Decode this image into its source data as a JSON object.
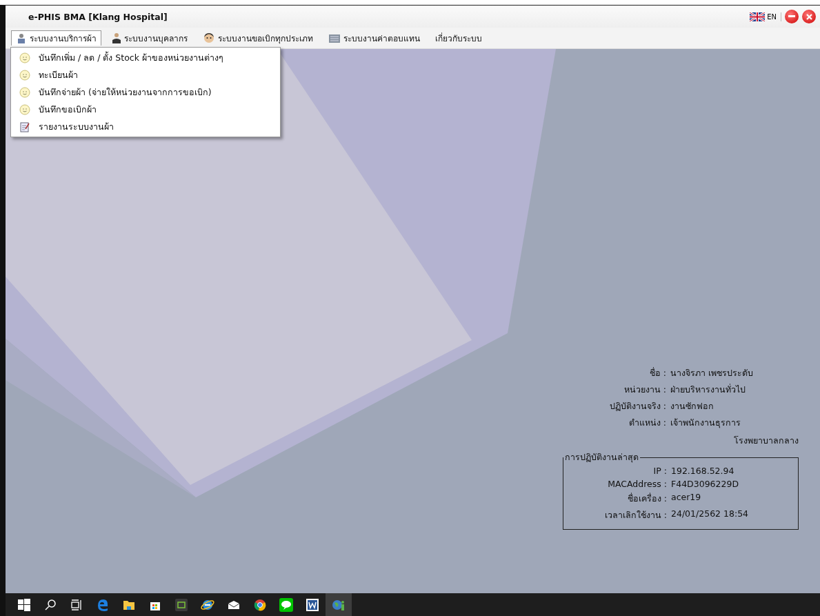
{
  "window": {
    "title": "e-PHIS BMA [Klang Hospital]",
    "language": "EN"
  },
  "menu": [
    {
      "label": "ระบบงานบริการผ้า",
      "kind": "staff",
      "selected": true
    },
    {
      "label": "ระบบงานบุคลากร",
      "kind": "person",
      "selected": false
    },
    {
      "label": "ระบบงานขอเบิกทุกประเภท",
      "kind": "face",
      "selected": false
    },
    {
      "label": "ระบบงานค่าตอบแทน",
      "kind": "building",
      "selected": false
    },
    {
      "label": "เกี่ยวกับระบบ",
      "selected": false
    }
  ],
  "dropdown": [
    {
      "label": "บันทึกเพิ่ม / ลด / ตั้ง Stock ผ้าของหน่วยงานต่างๆ",
      "kind": "face"
    },
    {
      "label": "ทะเบียนผ้า",
      "kind": "face"
    },
    {
      "label": "บันทึกจ่ายผ้า (จ่ายให้หน่วยงานจากการขอเบิก)",
      "kind": "face"
    },
    {
      "label": "บันทึกขอเบิกผ้า",
      "kind": "face"
    },
    {
      "label": "รายงานระบบงานผ้า",
      "kind": "report"
    }
  ],
  "user": [
    {
      "label": "ชื่อ :",
      "value": "นางจิรภา  เพชรประดับ"
    },
    {
      "label": "หน่วยงาน :",
      "value": "ฝ่ายบริหารงานทั่วไป"
    },
    {
      "label": "ปฏิบัติงานจริง :",
      "value": "งานซักฟอก"
    },
    {
      "label": "ตำแหน่ง :",
      "value": "เจ้าพนักงานธุรการ"
    }
  ],
  "hospital": "โรงพยาบาลกลาง",
  "last_session": {
    "title": "การปฏิบัติงานล่าสุด",
    "rows": [
      {
        "label": "IP :",
        "value": "192.168.52.94"
      },
      {
        "label": "MACAddress :",
        "value": "F44D3096229D"
      },
      {
        "label": "ชื่อเครื่อง :",
        "value": "acer19"
      },
      {
        "label": "เวลาเลิกใช้งาน :",
        "value": "24/01/2562  18:54"
      }
    ]
  },
  "taskbar": [
    {
      "kind": "start",
      "selected": false
    },
    {
      "kind": "search",
      "selected": false
    },
    {
      "kind": "taskview",
      "selected": false
    },
    {
      "kind": "edge",
      "selected": false
    },
    {
      "kind": "folder",
      "selected": false
    },
    {
      "kind": "store",
      "selected": false
    },
    {
      "kind": "app",
      "selected": false
    },
    {
      "kind": "ie",
      "selected": false
    },
    {
      "kind": "mail",
      "selected": false
    },
    {
      "kind": "chrome",
      "selected": false
    },
    {
      "kind": "chat",
      "selected": false
    },
    {
      "kind": "word",
      "selected": false
    },
    {
      "kind": "globe",
      "selected": true
    }
  ]
}
